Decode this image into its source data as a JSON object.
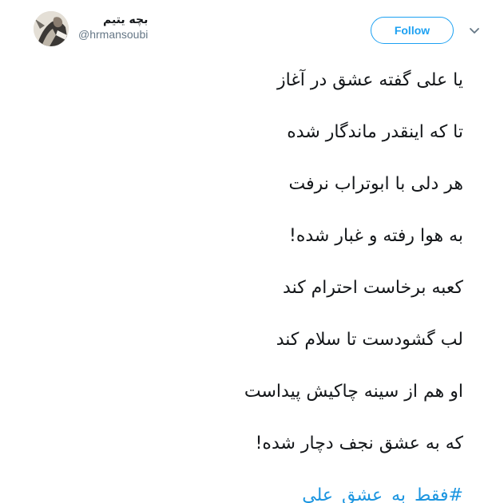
{
  "author": {
    "display_name": "بچه یتیم",
    "handle": "@hrmansoubi",
    "avatar_icon": "avatar-photo"
  },
  "actions": {
    "follow_label": "Follow",
    "more_icon": "chevron-down-icon"
  },
  "tweet": {
    "lines": [
      "یا علی گفته عشق در آغاز",
      "تا که اینقدر ماندگار شده",
      "هر دلی با ابوتراب نرفت",
      "به هوا رفته و غبار شده!",
      "کعبه برخاست احترام کند",
      "لب گشودست تا سلام کند",
      "او هم از سینه چاکیش پیداست",
      "که به عشق نجف دچار شده!"
    ],
    "hashtag": "#فقط_به_عشق_علی"
  },
  "colors": {
    "accent": "#1da1f2",
    "hashtag": "#1b95e0",
    "text": "#14171a",
    "secondary": "#657786"
  }
}
